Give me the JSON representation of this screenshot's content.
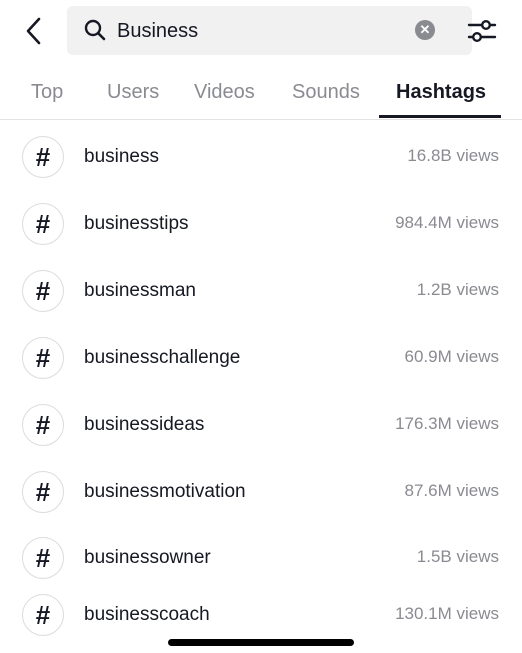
{
  "search": {
    "query": "Business"
  },
  "tabs": [
    {
      "label": "Top"
    },
    {
      "label": "Users"
    },
    {
      "label": "Videos"
    },
    {
      "label": "Sounds"
    },
    {
      "label": "Hashtags",
      "active": true
    }
  ],
  "hashtags": [
    {
      "symbol": "#",
      "name": "business",
      "views": "16.8B views"
    },
    {
      "symbol": "#",
      "name": "businesstips",
      "views": "984.4M views"
    },
    {
      "symbol": "#",
      "name": "businessman",
      "views": "1.2B views"
    },
    {
      "symbol": "#",
      "name": "businesschallenge",
      "views": "60.9M views"
    },
    {
      "symbol": "#",
      "name": "businessideas",
      "views": "176.3M views"
    },
    {
      "symbol": "#",
      "name": "businessmotivation",
      "views": "87.6M views"
    },
    {
      "symbol": "#",
      "name": "businessowner",
      "views": "1.5B views"
    },
    {
      "symbol": "#",
      "name": "businesscoach",
      "views": "130.1M views"
    }
  ],
  "icons": {
    "back": "chevron-left-icon",
    "search": "search-icon",
    "clear": "clear-icon",
    "filter": "filter-sliders-icon"
  },
  "colors": {
    "text": "#161823",
    "secondary": "#8a8b91",
    "searchBg": "#f1f1f2"
  }
}
